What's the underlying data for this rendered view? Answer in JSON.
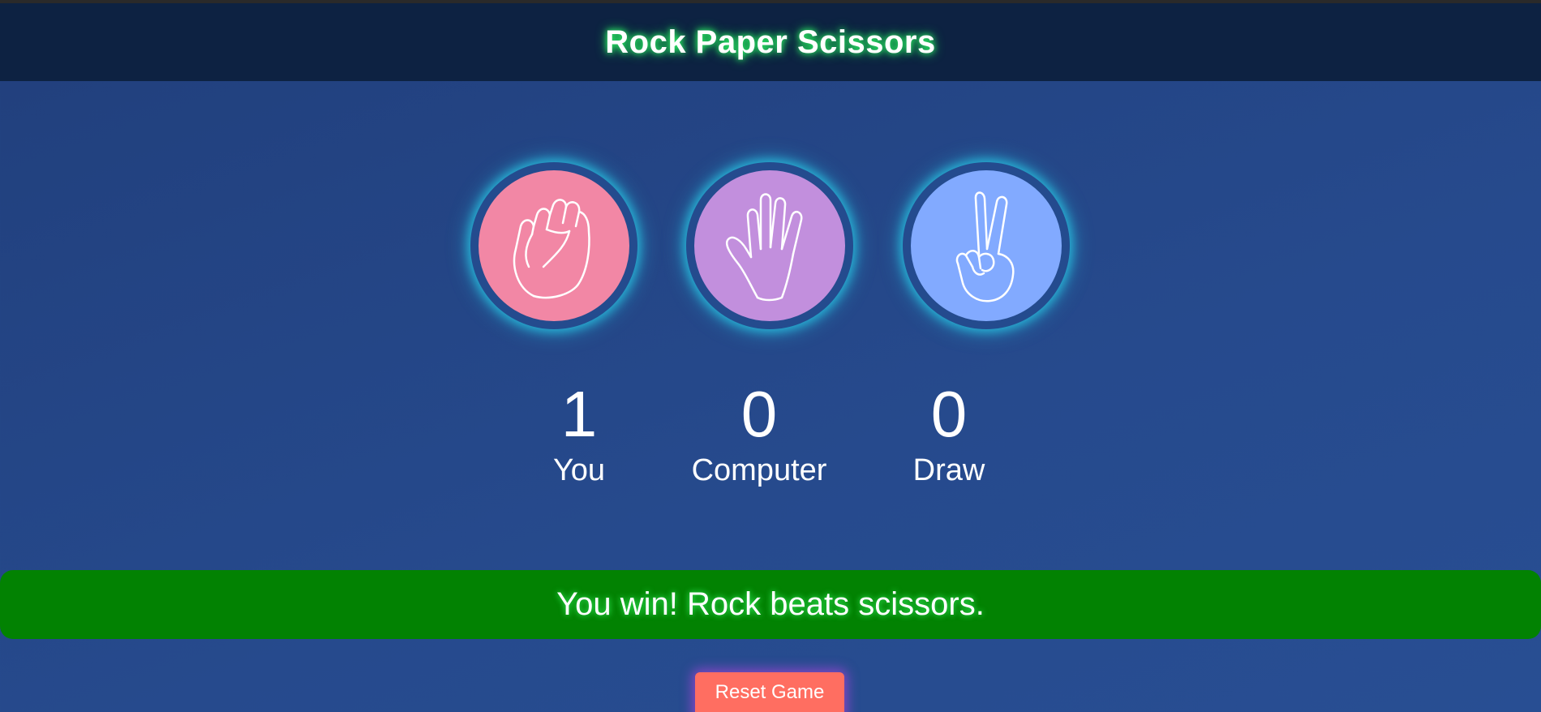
{
  "header": {
    "title": "Rock Paper Scissors"
  },
  "choices": [
    {
      "name": "rock",
      "icon": "fist-icon",
      "color": "#f287a5"
    },
    {
      "name": "paper",
      "icon": "open-hand-icon",
      "color": "#c28fdd"
    },
    {
      "name": "scissors",
      "icon": "peace-hand-icon",
      "color": "#82aaff"
    }
  ],
  "scores": {
    "you": {
      "value": "1",
      "label": "You"
    },
    "computer": {
      "value": "0",
      "label": "Computer"
    },
    "draw": {
      "value": "0",
      "label": "Draw"
    }
  },
  "result": {
    "message": "You win! Rock beats scissors.",
    "color": "#028202"
  },
  "controls": {
    "reset_label": "Reset Game"
  }
}
